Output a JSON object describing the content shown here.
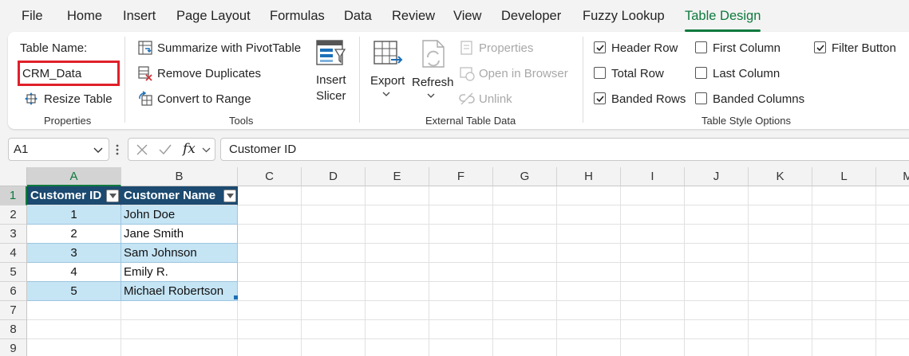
{
  "menu": {
    "tabs": [
      "File",
      "Home",
      "Insert",
      "Page Layout",
      "Formulas",
      "Data",
      "Review",
      "View",
      "Developer",
      "Fuzzy Lookup",
      "Table Design"
    ],
    "active": "Table Design"
  },
  "ribbon": {
    "properties": {
      "table_name_label": "Table Name:",
      "table_name_value": "CRM_Data",
      "resize_table": "Resize Table",
      "group_label": "Properties"
    },
    "tools": {
      "summarize_pivot": "Summarize with PivotTable",
      "remove_duplicates": "Remove Duplicates",
      "convert_to_range": "Convert to Range",
      "insert_slicer_line1": "Insert",
      "insert_slicer_line2": "Slicer",
      "group_label": "Tools"
    },
    "external": {
      "export": "Export",
      "refresh": "Refresh",
      "properties": "Properties",
      "open_in_browser": "Open in Browser",
      "unlink": "Unlink",
      "group_label": "External Table Data"
    },
    "style_options": {
      "header_row": {
        "label": "Header Row",
        "checked": true
      },
      "total_row": {
        "label": "Total Row",
        "checked": false
      },
      "banded_rows": {
        "label": "Banded Rows",
        "checked": true
      },
      "first_column": {
        "label": "First Column",
        "checked": false
      },
      "last_column": {
        "label": "Last Column",
        "checked": false
      },
      "banded_columns": {
        "label": "Banded Columns",
        "checked": false
      },
      "filter_button": {
        "label": "Filter Button",
        "checked": true
      },
      "group_label": "Table Style Options"
    }
  },
  "formula_bar": {
    "cell_ref": "A1",
    "fx": "fx",
    "content": "Customer ID"
  },
  "sheet": {
    "columns": [
      "A",
      "B",
      "C",
      "D",
      "E",
      "F",
      "G",
      "H",
      "I",
      "J",
      "K",
      "L",
      "M"
    ],
    "rows": [
      "1",
      "2",
      "3",
      "4",
      "5",
      "6",
      "7",
      "8",
      "9"
    ],
    "table": {
      "headers": [
        "Customer ID",
        "Customer Name"
      ],
      "rows": [
        [
          "1",
          "John Doe"
        ],
        [
          "2",
          "Jane Smith"
        ],
        [
          "3",
          "Sam Johnson"
        ],
        [
          "4",
          "Emily R."
        ],
        [
          "5",
          "Michael Robertson"
        ]
      ]
    }
  },
  "colors": {
    "accent": "#0e7a3e",
    "table_header": "#1c4a70",
    "band": "#c5e4f4",
    "highlight_border": "#e0202a"
  }
}
